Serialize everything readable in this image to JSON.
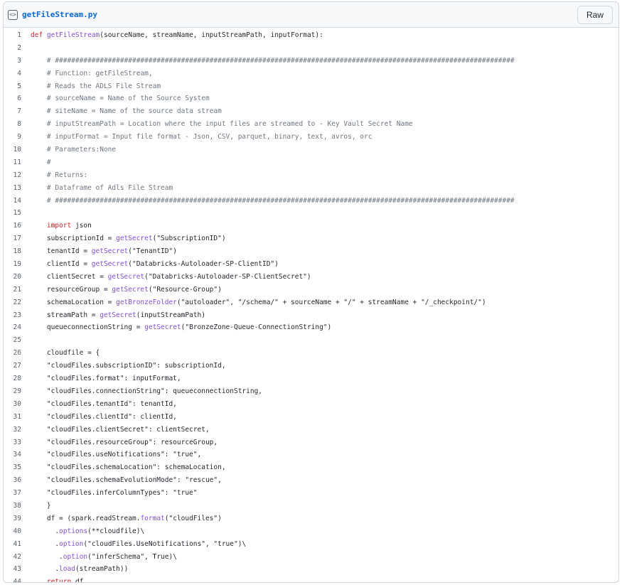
{
  "file": {
    "name": "getFileStream.py",
    "raw_label": "Raw",
    "icon": "code-file-icon"
  },
  "colors": {
    "keyword": "#cf222e",
    "function": "#8250df",
    "comment": "#6e7781",
    "string": "#0a3069",
    "link": "#0969da"
  },
  "lines": [
    [
      [
        "k",
        "def "
      ],
      [
        "f",
        "getFileStream"
      ],
      [
        "t",
        "(sourceName, streamName, inputStreamPath, inputFormat):"
      ]
    ],
    [],
    [
      [
        "t",
        "    "
      ],
      [
        "c",
        "# #################################################################################################################"
      ]
    ],
    [
      [
        "t",
        "    "
      ],
      [
        "c",
        "# Function: getFileStream,"
      ]
    ],
    [
      [
        "t",
        "    "
      ],
      [
        "c",
        "# Reads the ADLS File Stream"
      ]
    ],
    [
      [
        "t",
        "    "
      ],
      [
        "c",
        "# sourceName = Name of the Source System"
      ]
    ],
    [
      [
        "t",
        "    "
      ],
      [
        "c",
        "# siteName = Name of the source data stream"
      ]
    ],
    [
      [
        "t",
        "    "
      ],
      [
        "c",
        "# inputStreamPath = Location where the input files are streamed to - Key Vault Secret Name"
      ]
    ],
    [
      [
        "t",
        "    "
      ],
      [
        "c",
        "# inputFormat = Input file format - Json, CSV, parquet, binary, text, avros, orc"
      ]
    ],
    [
      [
        "t",
        "    "
      ],
      [
        "c",
        "# Parameters:None"
      ]
    ],
    [
      [
        "t",
        "    "
      ],
      [
        "c",
        "#"
      ]
    ],
    [
      [
        "t",
        "    "
      ],
      [
        "c",
        "# Returns:"
      ]
    ],
    [
      [
        "t",
        "    "
      ],
      [
        "c",
        "# Dataframe of Adls File Stream"
      ]
    ],
    [
      [
        "t",
        "    "
      ],
      [
        "c",
        "# #################################################################################################################"
      ]
    ],
    [],
    [
      [
        "t",
        "    "
      ],
      [
        "k",
        "import"
      ],
      [
        "t",
        " json"
      ]
    ],
    [
      [
        "t",
        "    subscriptionId = "
      ],
      [
        "f",
        "getSecret"
      ],
      [
        "t",
        "(\"SubscriptionID\")"
      ]
    ],
    [
      [
        "t",
        "    tenantId = "
      ],
      [
        "f",
        "getSecret"
      ],
      [
        "t",
        "(\"TenantID\")"
      ]
    ],
    [
      [
        "t",
        "    clientId = "
      ],
      [
        "f",
        "getSecret"
      ],
      [
        "t",
        "(\"Databricks-Autoloader-SP-ClientID\")"
      ]
    ],
    [
      [
        "t",
        "    clientSecret = "
      ],
      [
        "f",
        "getSecret"
      ],
      [
        "t",
        "(\"Databricks-Autoloader-SP-ClientSecret\")"
      ]
    ],
    [
      [
        "t",
        "    resourceGroup = "
      ],
      [
        "f",
        "getSecret"
      ],
      [
        "t",
        "(\"Resource-Group\")"
      ]
    ],
    [
      [
        "t",
        "    schemaLocation = "
      ],
      [
        "f",
        "getBronzeFolder"
      ],
      [
        "t",
        "(\"autoloader\", \"/schema/\" + sourceName + \"/\" + streamName + \"/_checkpoint/\")"
      ]
    ],
    [
      [
        "t",
        "    streamPath = "
      ],
      [
        "f",
        "getSecret"
      ],
      [
        "t",
        "(inputStreamPath)"
      ]
    ],
    [
      [
        "t",
        "    queueconnectionString = "
      ],
      [
        "f",
        "getSecret"
      ],
      [
        "t",
        "(\"BronzeZone-Queue-ConnectionString\")"
      ]
    ],
    [],
    [
      [
        "t",
        "    cloudfile = {"
      ]
    ],
    [
      [
        "t",
        "    \"cloudFiles.subscriptionID\": subscriptionId,"
      ]
    ],
    [
      [
        "t",
        "    \"cloudFiles.format\": inputFormat,"
      ]
    ],
    [
      [
        "t",
        "    \"cloudFiles.connectionString\": queueconnectionString,"
      ]
    ],
    [
      [
        "t",
        "    \"cloudFiles.tenantId\": tenantId,"
      ]
    ],
    [
      [
        "t",
        "    \"cloudFiles.clientId\": clientId,"
      ]
    ],
    [
      [
        "t",
        "    \"cloudFiles.clientSecret\": clientSecret,"
      ]
    ],
    [
      [
        "t",
        "    \"cloudFiles.resourceGroup\": resourceGroup,"
      ]
    ],
    [
      [
        "t",
        "    \"cloudFiles.useNotifications\": \"true\","
      ]
    ],
    [
      [
        "t",
        "    \"cloudFiles.schemaLocation\": schemaLocation,"
      ]
    ],
    [
      [
        "t",
        "    \"cloudFiles.schemaEvolutionMode\": \"rescue\","
      ]
    ],
    [
      [
        "t",
        "    \"cloudFiles.inferColumnTypes\": \"true\""
      ]
    ],
    [
      [
        "t",
        "    }"
      ]
    ],
    [
      [
        "t",
        "    df = (spark.readStream."
      ],
      [
        "f",
        "format"
      ],
      [
        "t",
        "(\"cloudFiles\")"
      ]
    ],
    [
      [
        "t",
        "      ."
      ],
      [
        "f",
        "options"
      ],
      [
        "t",
        "(**cloudfile)\\"
      ]
    ],
    [
      [
        "t",
        "      ."
      ],
      [
        "f",
        "option"
      ],
      [
        "t",
        "(\"cloudFiles.UseNotifications\", \"true\")\\"
      ]
    ],
    [
      [
        "t",
        "       ."
      ],
      [
        "f",
        "option"
      ],
      [
        "t",
        "(\"inferSchema\", True)\\"
      ]
    ],
    [
      [
        "t",
        "      ."
      ],
      [
        "f",
        "load"
      ],
      [
        "t",
        "(streamPath))"
      ]
    ],
    [
      [
        "t",
        "    "
      ],
      [
        "k",
        "return"
      ],
      [
        "t",
        " df"
      ]
    ]
  ]
}
